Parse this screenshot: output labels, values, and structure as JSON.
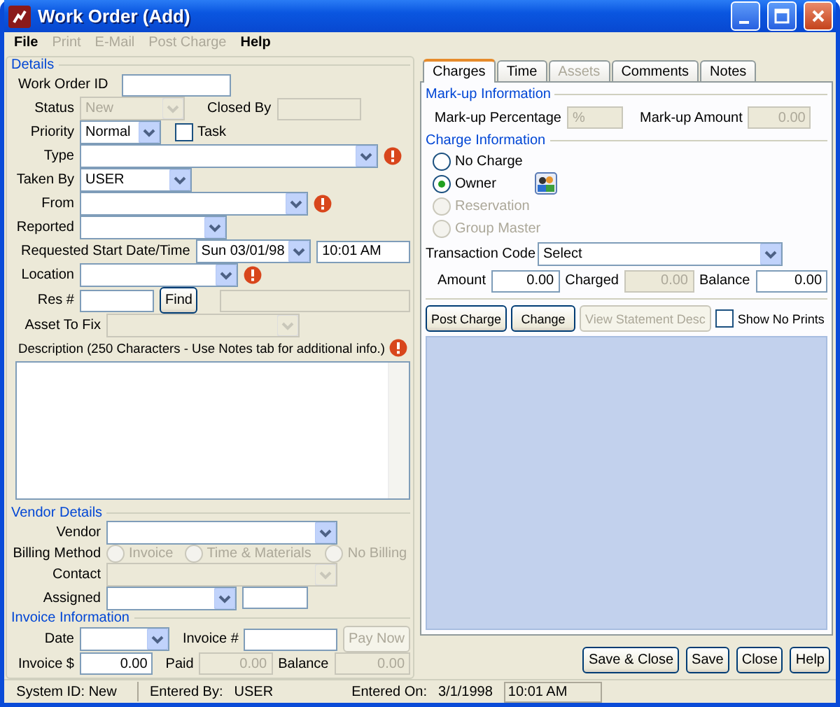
{
  "window": {
    "title": "Work Order (Add)"
  },
  "menu": [
    {
      "label": "File",
      "disabled": false
    },
    {
      "label": "Print",
      "disabled": true
    },
    {
      "label": "E-Mail",
      "disabled": true
    },
    {
      "label": "Post Charge",
      "disabled": true
    },
    {
      "label": "Help",
      "disabled": false
    }
  ],
  "details": {
    "legend": "Details",
    "work_order_id": {
      "label": "Work Order ID"
    },
    "status": {
      "label": "Status",
      "value": "New",
      "disabled": true
    },
    "closed_by": {
      "label": "Closed By",
      "disabled": true
    },
    "priority": {
      "label": "Priority",
      "value": "Normal"
    },
    "task": {
      "label": "Task",
      "checked": false
    },
    "type": {
      "label": "Type",
      "required": true
    },
    "taken_by": {
      "label": "Taken By",
      "value": "USER"
    },
    "from": {
      "label": "From",
      "required": true
    },
    "reported": {
      "label": "Reported"
    },
    "requested_start": {
      "label": "Requested Start Date/Time",
      "date": "Sun 03/01/98",
      "time": "10:01 AM"
    },
    "location": {
      "label": "Location",
      "required": true
    },
    "res_no": {
      "label": "Res #",
      "button": "Find"
    },
    "asset": {
      "label": "Asset To Fix",
      "disabled": true
    },
    "description": {
      "label": "Description (250 Characters - Use Notes tab for additional info.)",
      "required": true
    }
  },
  "vendor": {
    "legend": "Vendor Details",
    "vendor": {
      "label": "Vendor"
    },
    "billing": {
      "label": "Billing Method",
      "options": [
        {
          "label": "Invoice",
          "selected": false,
          "disabled": true
        },
        {
          "label": "Time & Materials",
          "selected": false,
          "disabled": true
        },
        {
          "label": "No Billing",
          "selected": false,
          "disabled": true
        }
      ]
    },
    "contact": {
      "label": "Contact",
      "disabled": true
    },
    "assigned": {
      "label": "Assigned"
    }
  },
  "invoice": {
    "legend": "Invoice Information",
    "date": {
      "label": "Date"
    },
    "invoice_no": {
      "label": "Invoice #"
    },
    "pay_now": {
      "label": "Pay Now",
      "disabled": true
    },
    "invoice_amount": {
      "label": "Invoice $",
      "value": "0.00"
    },
    "paid": {
      "label": "Paid",
      "value": "0.00",
      "disabled": true
    },
    "balance": {
      "label": "Balance",
      "value": "0.00",
      "disabled": true
    }
  },
  "tabs": [
    {
      "label": "Charges",
      "selected": true,
      "disabled": false
    },
    {
      "label": "Time",
      "selected": false,
      "disabled": false
    },
    {
      "label": "Assets",
      "selected": false,
      "disabled": true
    },
    {
      "label": "Comments",
      "selected": false,
      "disabled": false
    },
    {
      "label": "Notes",
      "selected": false,
      "disabled": false
    }
  ],
  "markup": {
    "legend": "Mark-up Information",
    "percentage": {
      "label": "Mark-up Percentage",
      "value": "%",
      "disabled": true
    },
    "amount": {
      "label": "Mark-up Amount",
      "value": "0.00",
      "disabled": true
    }
  },
  "charge": {
    "legend": "Charge Information",
    "options": [
      {
        "label": "No Charge",
        "selected": false,
        "disabled": false,
        "icon": false
      },
      {
        "label": "Owner",
        "selected": true,
        "disabled": false,
        "icon": true
      },
      {
        "label": "Reservation",
        "selected": false,
        "disabled": true,
        "icon": false
      },
      {
        "label": "Group Master",
        "selected": false,
        "disabled": true,
        "icon": false
      }
    ],
    "transaction_code": {
      "label": "Transaction Code",
      "value": "Select"
    },
    "amount": {
      "label": "Amount",
      "value": "0.00",
      "disabled": false
    },
    "charged": {
      "label": "Charged",
      "value": "0.00",
      "disabled": true
    },
    "balance": {
      "label": "Balance",
      "value": "0.00",
      "disabled": false
    },
    "buttons": [
      {
        "label": "Post Charge",
        "disabled": false
      },
      {
        "label": "Change",
        "disabled": false
      },
      {
        "label": "View Statement Desc",
        "disabled": true
      }
    ],
    "show_no_prints": {
      "label": "Show No Prints",
      "checked": false
    }
  },
  "footer_buttons": [
    {
      "label": "Save & Close"
    },
    {
      "label": "Save"
    },
    {
      "label": "Close"
    },
    {
      "label": "Help"
    }
  ],
  "status_bar": {
    "system_id": "System ID: New",
    "entered_by_label": "Entered By:",
    "entered_by": "USER",
    "entered_on_label": "Entered On:",
    "entered_on": "3/1/1998",
    "time": "10:01 AM"
  }
}
